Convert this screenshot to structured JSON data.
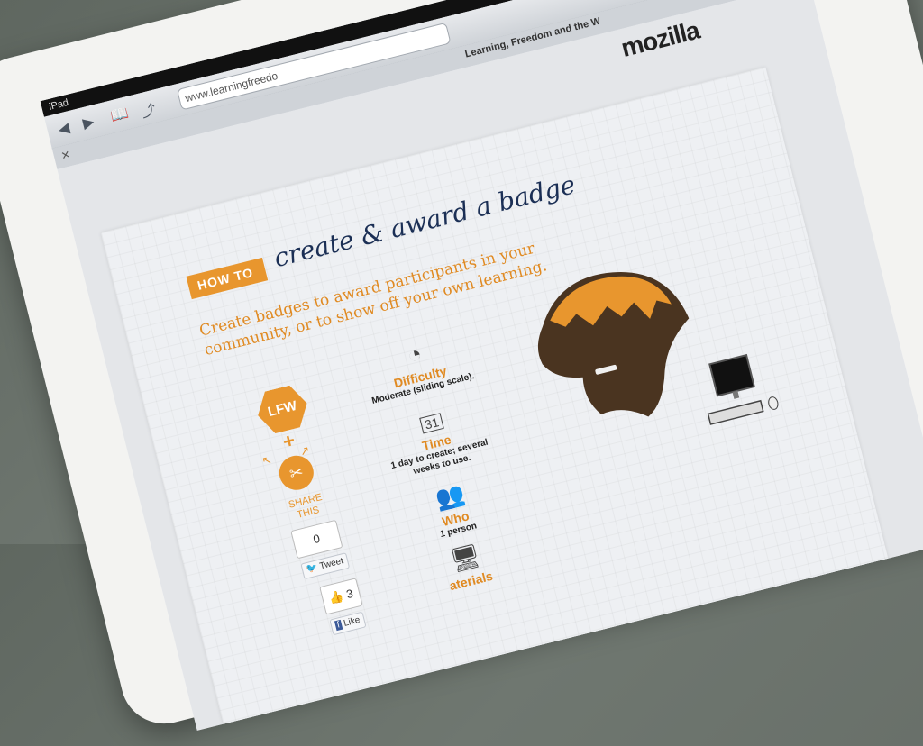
{
  "device": {
    "status_label": "iPad"
  },
  "browser": {
    "url": "www.learningfreedo",
    "tab_title": "Learning, Freedom and the W"
  },
  "page": {
    "logo": "mozilla",
    "howto_badge": "HOW TO",
    "title": "create & award a badge",
    "intro": "Create badges to award participants in your community, or to show off your own learning.",
    "lfw_label": "LFW",
    "share_label": "SHARE THIS",
    "share_count": "0",
    "tweet_label": "Tweet",
    "like_count": "3",
    "like_label": "Like",
    "specs": [
      {
        "title": "Difficulty",
        "text": "Moderate (sliding scale).",
        "icon": "gauge-icon"
      },
      {
        "title": "Time",
        "text": "1 day to create; several weeks to use.",
        "icon": "calendar-icon",
        "day": "31"
      },
      {
        "title": "Who",
        "text": "1 person",
        "icon": "people-icon"
      },
      {
        "title": "aterials",
        "icon": "computer-icon"
      }
    ]
  },
  "colors": {
    "accent": "#e8962e",
    "title_navy": "#1b2f55"
  }
}
